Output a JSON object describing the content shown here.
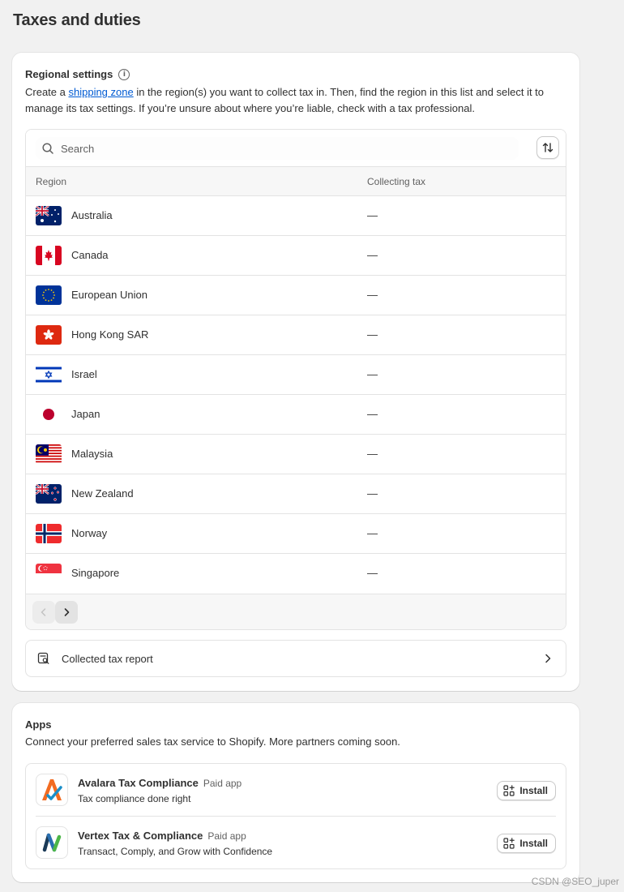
{
  "page": {
    "title": "Taxes and duties"
  },
  "regional": {
    "heading": "Regional settings",
    "desc_before": "Create a ",
    "desc_link": "shipping zone",
    "desc_after": " in the region(s) you want to collect tax in. Then, find the region in this list and select it to manage its tax settings. If you’re unsure about where you’re liable, check with a tax professional.",
    "search_placeholder": "Search",
    "columns": {
      "region": "Region",
      "tax": "Collecting tax"
    },
    "rows": [
      {
        "name": "Australia",
        "tax": "—",
        "flag": "au-flag-icon"
      },
      {
        "name": "Canada",
        "tax": "—",
        "flag": "ca-flag-icon"
      },
      {
        "name": "European Union",
        "tax": "—",
        "flag": "eu-flag-icon"
      },
      {
        "name": "Hong Kong SAR",
        "tax": "—",
        "flag": "hk-flag-icon"
      },
      {
        "name": "Israel",
        "tax": "—",
        "flag": "il-flag-icon"
      },
      {
        "name": "Japan",
        "tax": "—",
        "flag": "jp-flag-icon"
      },
      {
        "name": "Malaysia",
        "tax": "—",
        "flag": "my-flag-icon"
      },
      {
        "name": "New Zealand",
        "tax": "—",
        "flag": "nz-flag-icon"
      },
      {
        "name": "Norway",
        "tax": "—",
        "flag": "no-flag-icon"
      },
      {
        "name": "Singapore",
        "tax": "—",
        "flag": "sg-flag-icon"
      }
    ],
    "report_label": "Collected tax report"
  },
  "apps": {
    "heading": "Apps",
    "desc": "Connect your preferred sales tax service to Shopify. More partners coming soon.",
    "items": [
      {
        "name": "Avalara Tax Compliance",
        "badge": "Paid app",
        "tagline": "Tax compliance done right",
        "install": "Install"
      },
      {
        "name": "Vertex Tax & Compliance",
        "badge": "Paid app",
        "tagline": "Transact, Comply, and Grow with Confidence",
        "install": "Install"
      }
    ]
  },
  "watermark": "CSDN @SEO_juper",
  "colors": {
    "link": "#005bd3",
    "background": "#f1f1f1",
    "card": "#ffffff",
    "border": "#e3e3e3"
  }
}
